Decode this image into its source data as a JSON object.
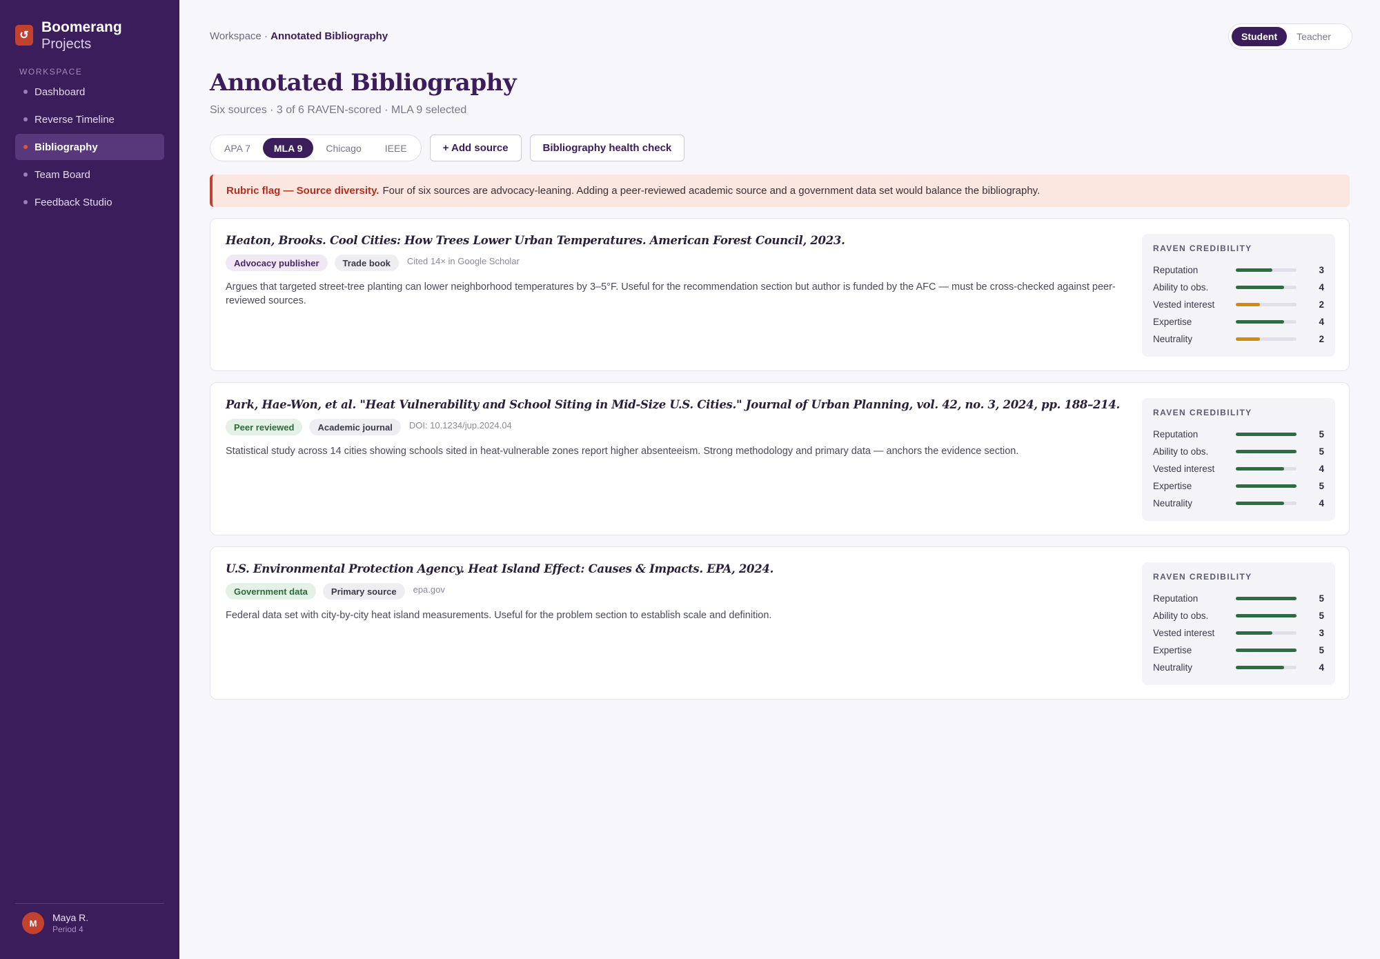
{
  "brand": {
    "logo_glyph": "↺",
    "name": "Boomerang",
    "sub": "Projects",
    "color": "#c2412f"
  },
  "sidebar": {
    "section": "WORKSPACE",
    "items": [
      {
        "label": "Dashboard"
      },
      {
        "label": "Reverse Timeline"
      },
      {
        "label": "Bibliography"
      },
      {
        "label": "Team Board"
      },
      {
        "label": "Feedback Studio"
      }
    ]
  },
  "user": {
    "initial": "M",
    "name": "Maya R.",
    "period": "Period 4"
  },
  "breadcrumb": {
    "root": "Workspace",
    "sep": "·",
    "current": "Annotated Bibliography"
  },
  "roles": {
    "student": "Student",
    "teacher": "Teacher"
  },
  "page": {
    "title": "Annotated Bibliography",
    "subtitle": "Six sources · 3 of 6 RAVEN-scored · MLA 9 selected"
  },
  "styles": {
    "apa": "APA 7",
    "mla": "MLA 9",
    "chicago": "Chicago",
    "ieee": "IEEE"
  },
  "toolbar": {
    "add_source": "+ Add source",
    "health_check": "Bibliography health check"
  },
  "alert": {
    "flag": "Rubric flag — Source diversity.",
    "text": "Four of six sources are advocacy-leaning. Adding a peer-reviewed academic source and a government data set would balance the bibliography."
  },
  "raven": {
    "title": "RAVEN CREDIBILITY",
    "max": 5,
    "labels": [
      "Reputation",
      "Ability to obs.",
      "Vested interest",
      "Expertise",
      "Neutrality"
    ]
  },
  "sources": [
    {
      "citation": "Heaton, Brooks. Cool Cities: How Trees Lower Urban Temperatures. American Forest Council, 2023.",
      "tag1": "Advocacy publisher",
      "tag2": "Trade book",
      "meta": "Cited 14× in Google Scholar",
      "annotation": "Argues that targeted street-tree planting can lower neighborhood temperatures by 3–5°F. Useful for the recommendation section but author is funded by the AFC — must be cross-checked against peer-reviewed sources.",
      "scores": [
        3,
        4,
        2,
        4,
        2
      ]
    },
    {
      "citation": "Park, Hae-Won, et al. \"Heat Vulnerability and School Siting in Mid-Size U.S. Cities.\" Journal of Urban Planning, vol. 42, no. 3, 2024, pp. 188–214.",
      "tag1": "Peer reviewed",
      "tag2": "Academic journal",
      "meta": "DOI: 10.1234/jup.2024.04",
      "annotation": "Statistical study across 14 cities showing schools sited in heat-vulnerable zones report higher absenteeism. Strong methodology and primary data — anchors the evidence section.",
      "scores": [
        5,
        5,
        4,
        5,
        4
      ]
    },
    {
      "citation": "U.S. Environmental Protection Agency. Heat Island Effect: Causes & Impacts. EPA, 2024.",
      "tag1": "Government data",
      "tag2": "Primary source",
      "meta": "epa.gov",
      "annotation": "Federal data set with city-by-city heat island measurements. Useful for the problem section to establish scale and definition.",
      "scores": [
        5,
        5,
        3,
        5,
        4
      ]
    }
  ]
}
